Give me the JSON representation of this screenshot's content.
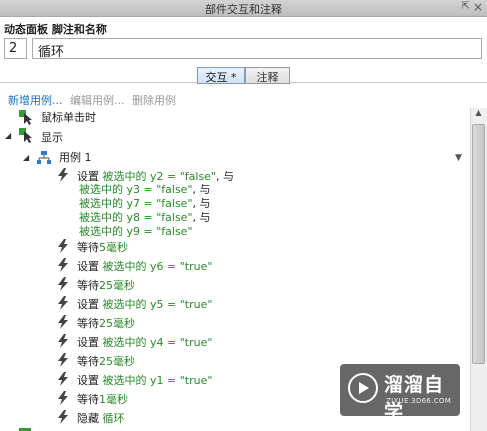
{
  "window": {
    "title": "部件交互和注释"
  },
  "header": {
    "section_label": "动态面板 脚注和名称",
    "footnote_number": "2",
    "widget_name": "循环"
  },
  "tabs": [
    {
      "label": "交互 *",
      "active": true
    },
    {
      "label": "注释",
      "active": false
    }
  ],
  "case_actions": {
    "add": "新增用例...",
    "edit": "编辑用例...",
    "delete": "删除用例"
  },
  "events": [
    {
      "label": "鼠标单击时"
    },
    {
      "label": "显示"
    }
  ],
  "case": {
    "label": "用例 1"
  },
  "actions": [
    {
      "verb": "设置",
      "lines": [
        {
          "target": "被选中的 y2 = \"false\"",
          "suffix": ", 与"
        },
        {
          "target": "被选中的 y3 = \"false\"",
          "suffix": ", 与"
        },
        {
          "target": "被选中的 y7 = \"false\"",
          "suffix": ", 与"
        },
        {
          "target": "被选中的 y8 = \"false\"",
          "suffix": ", 与"
        },
        {
          "target": "被选中的 y9 = \"false\"",
          "suffix": ""
        }
      ]
    },
    {
      "verb": "等待",
      "value": "5毫秒"
    },
    {
      "verb": "设置",
      "value": "被选中的 y6 = \"true\""
    },
    {
      "verb": "等待",
      "value": "25毫秒"
    },
    {
      "verb": "设置",
      "value": "被选中的 y5 = \"true\""
    },
    {
      "verb": "等待",
      "value": "25毫秒"
    },
    {
      "verb": "设置",
      "value": "被选中的 y4 = \"true\""
    },
    {
      "verb": "等待",
      "value": "25毫秒"
    },
    {
      "verb": "设置",
      "value": "被选中的 y1 = \"true\""
    },
    {
      "verb": "等待",
      "value": "1毫秒"
    },
    {
      "verb": "隐藏",
      "value": "循环"
    }
  ],
  "watermark": {
    "title": "溜溜自学",
    "url": "ZIXUE.3D66.COM"
  },
  "colors": {
    "link": "#1a6fc6",
    "green": "#2a8a2a",
    "event_green": "#3a9a3a"
  },
  "icons": {
    "event": "cursor-event-icon",
    "action": "lightning-icon",
    "case": "case-tree-icon"
  }
}
